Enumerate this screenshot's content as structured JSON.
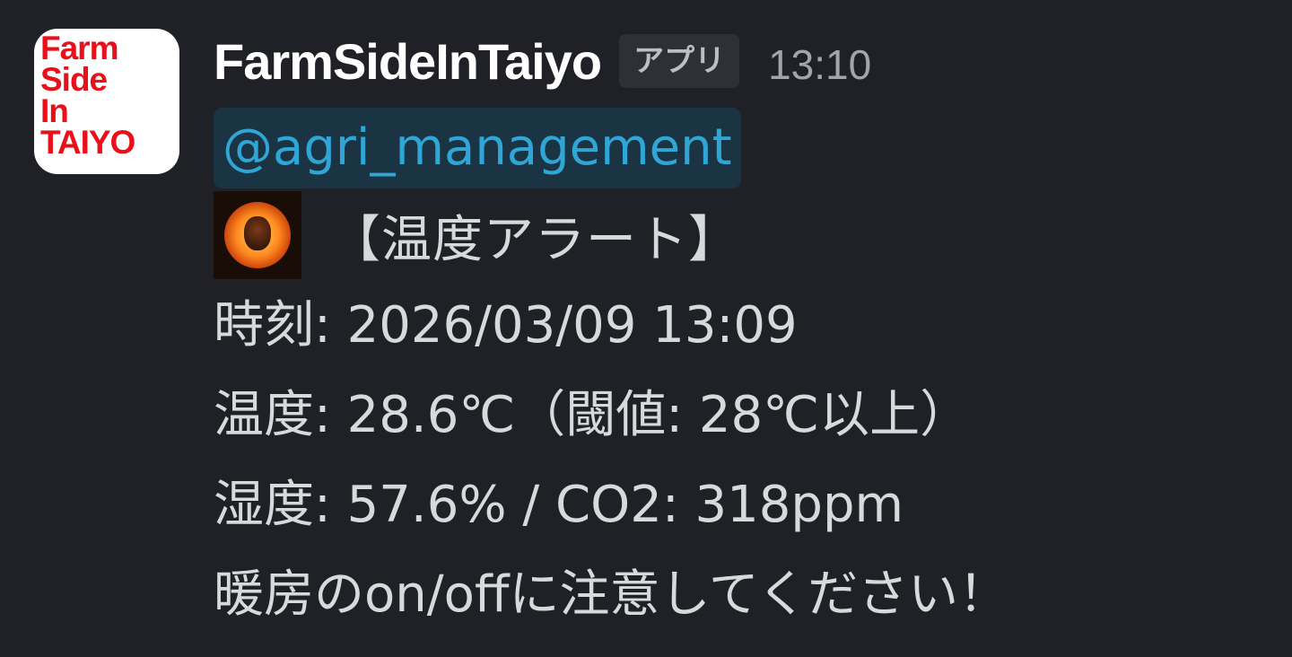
{
  "message": {
    "avatar": {
      "logo_text": "Farm\nSide\nIn\nTAIYO"
    },
    "sender": "FarmSideInTaiyo",
    "app_badge": "アプリ",
    "timestamp": "13:10",
    "mention": "@agri_management",
    "alert_emoji": "sun-face-emoji",
    "alert_title": "【温度アラート】",
    "lines": [
      "時刻: 2026/03/09 13:09",
      "温度: 28.6℃（閾値: 28℃以上）",
      "湿度: 57.6% / CO2: 318ppm",
      "暖房のon/offに注意してください！"
    ]
  },
  "colors": {
    "background": "#1f2126",
    "mention_text": "#2fa6d6",
    "mention_bg": "#1b3444",
    "logo_red": "#e8101a"
  }
}
